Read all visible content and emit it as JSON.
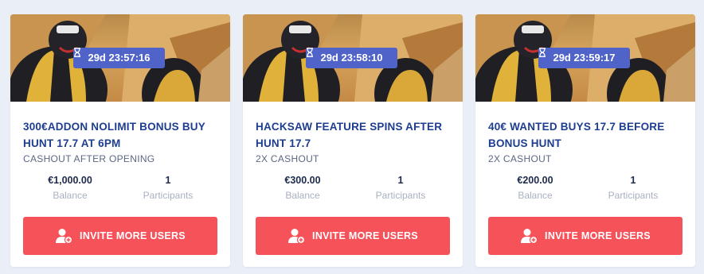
{
  "colors": {
    "page_background": "#e9eef7",
    "card_background": "#ffffff",
    "title": "#1d3d8f",
    "timer_badge": "#4f63c8",
    "invite_button": "#f5525a",
    "stat_label": "#a8b0c2"
  },
  "cards": [
    {
      "timer": "29d 23:57:16",
      "title": "300€ADDON NOLIMIT BONUS BUY HUNT 17.7 AT 6PM",
      "subtitle": "CASHOUT AFTER OPENING",
      "balance_value": "€1,000.00",
      "balance_label": "Balance",
      "participants_value": "1",
      "participants_label": "Participants",
      "button_label": "INVITE MORE USERS",
      "button_icon": "add-user-icon",
      "timer_icon": "hourglass-icon"
    },
    {
      "timer": "29d 23:58:10",
      "title": "HACKSAW FEATURE SPINS AFTER HUNT 17.7",
      "subtitle": "2X CASHOUT",
      "balance_value": "€300.00",
      "balance_label": "Balance",
      "participants_value": "1",
      "participants_label": "Participants",
      "button_label": "INVITE MORE USERS",
      "button_icon": "add-user-icon",
      "timer_icon": "hourglass-icon"
    },
    {
      "timer": "29d 23:59:17",
      "title": "40€ WANTED BUYS 17.7 BEFORE BONUS HUNT",
      "subtitle": "2X CASHOUT",
      "balance_value": "€200.00",
      "balance_label": "Balance",
      "participants_value": "1",
      "participants_label": "Participants",
      "button_label": "INVITE MORE USERS",
      "button_icon": "add-user-icon",
      "timer_icon": "hourglass-icon"
    }
  ]
}
